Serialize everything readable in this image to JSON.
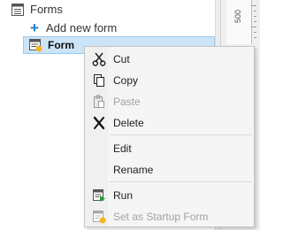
{
  "tree": {
    "forms_label": "Forms",
    "add_new_form_label": "Add new form",
    "selected_form_label": "Form"
  },
  "ruler": {
    "label": "500"
  },
  "context_menu": {
    "items": [
      {
        "label": "Cut",
        "icon": "scissors-icon",
        "enabled": true
      },
      {
        "label": "Copy",
        "icon": "copy-icon",
        "enabled": true
      },
      {
        "label": "Paste",
        "icon": "paste-icon",
        "enabled": false
      },
      {
        "label": "Delete",
        "icon": "delete-x-icon",
        "enabled": true
      },
      {
        "label": "Edit",
        "icon": "",
        "enabled": true
      },
      {
        "label": "Rename",
        "icon": "",
        "enabled": true
      },
      {
        "label": "Run",
        "icon": "run-form-icon",
        "enabled": true
      },
      {
        "label": "Set as Startup Form",
        "icon": "startup-form-icon",
        "enabled": false
      }
    ]
  },
  "colors": {
    "selection_background": "#cce4f7",
    "selection_border": "#99c9ef",
    "add_icon": "#1e7ac6",
    "run_icon": "#2a9d3a",
    "startup_icon": "#f0b429",
    "disabled_text": "#a2a2a2"
  }
}
